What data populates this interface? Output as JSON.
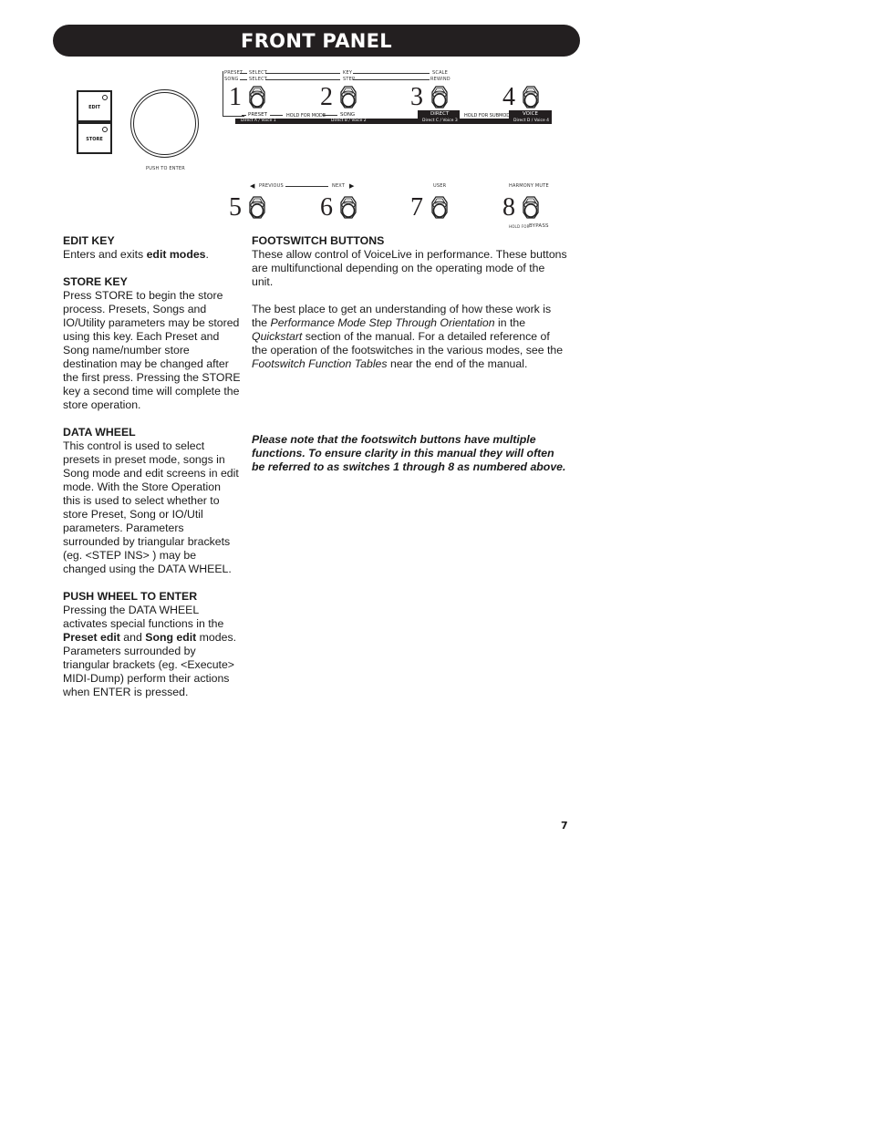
{
  "header": {
    "title": "FRONT PANEL"
  },
  "diagram": {
    "edit_key_label": "EDIT",
    "store_key_label": "STORE",
    "wheel_caption": "PUSH TO ENTER",
    "top_row": {
      "mode_labels": {
        "preset": "PRESET",
        "song": "SONG"
      },
      "preset_line": [
        "SELECT",
        "KEY",
        "SCALE"
      ],
      "song_line": [
        "SELECT",
        "STEP",
        "REWIND"
      ],
      "switches": [
        {
          "number": "1",
          "label": "PRESET",
          "sub": "Direct A / Voice 1"
        },
        {
          "number": "2",
          "label": "SONG",
          "sub": "Direct B / Voice 2"
        },
        {
          "number": "3",
          "label": "DIRECT",
          "sub": "Direct C / Voice 3"
        },
        {
          "number": "4",
          "label": "VOICE",
          "sub": "Direct D / Voice 4"
        }
      ],
      "hold_for_mode": "HOLD FOR MODE",
      "hold_for_submode": "HOLD FOR SUBMODE"
    },
    "bottom_row": {
      "previous": "PREVIOUS",
      "next": "NEXT",
      "switches": [
        {
          "number": "5",
          "label": ""
        },
        {
          "number": "6",
          "label": ""
        },
        {
          "number": "7",
          "label": "USER"
        },
        {
          "number": "8",
          "label": "HARMONY MUTE"
        }
      ],
      "hold_for": "HOLD FOR",
      "bypass": "BYPASS"
    }
  },
  "left_column": {
    "edit_key": {
      "heading": "EDIT KEY",
      "text_before": "Enters and exits ",
      "bold": "edit modes",
      "text_after": "."
    },
    "store_key": {
      "heading": "STORE KEY",
      "body": "Press STORE to begin the store process. Presets, Songs and IO/Utility parameters may be stored using this key. Each Preset and Song name/number store destination may be changed after the first press. Pressing the STORE key a second time will complete the store operation."
    },
    "data_wheel": {
      "heading": "DATA WHEEL",
      "body": "This control is used to select presets in preset mode, songs in Song mode and edit screens in edit mode. With the Store Operation this is used to select whether to store Preset, Song or IO/Util parameters. Parameters surrounded by triangular brackets (eg. <STEP INS> ) may be changed using the DATA WHEEL."
    },
    "push_wheel": {
      "heading": "PUSH WHEEL TO ENTER",
      "t1": "Pressing the DATA WHEEL activates special functions in the ",
      "b1": "Preset edit",
      "t2": " and ",
      "b2": "Song edit",
      "t3": " modes.  Parameters surrounded by triangular brackets (eg. <Execute> MIDI-Dump) perform their actions when ENTER is pressed."
    }
  },
  "right_column": {
    "footswitch": {
      "heading": "FOOTSWITCH BUTTONS",
      "p1": "These allow control of VoiceLive in performance. These buttons are multifunctional depending on the operating mode of the unit.",
      "p2_t1": "The best place to get an understanding of how these work is the ",
      "p2_i1": "Performance Mode Step Through Orientation",
      "p2_t2": " in the ",
      "p2_i2": "Quickstart",
      "p2_t3": " section of the manual.  For a detailed reference of the operation of the footswitches in the various modes, see the ",
      "p2_i3": "Footswitch Function Tables",
      "p2_t4": " near the end of the manual."
    },
    "note": "Please note that the footswitch buttons have multiple functions. To ensure clarity in this manual they will often be referred to as switches 1 through 8 as numbered above."
  },
  "footer": {
    "page_number": "7"
  }
}
